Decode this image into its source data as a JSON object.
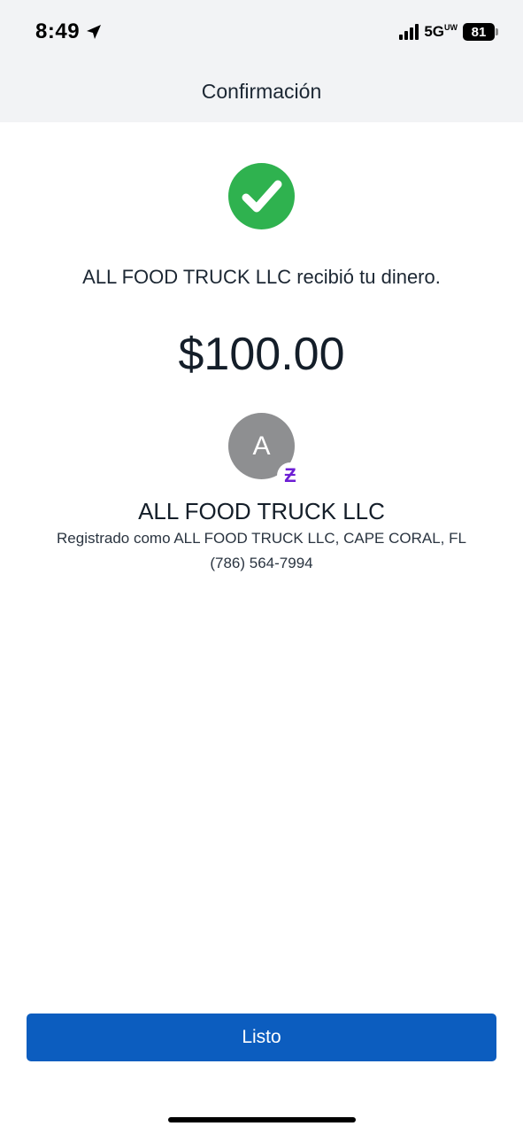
{
  "status_bar": {
    "time": "8:49",
    "location_icon": "location-arrow-icon",
    "network": "5G",
    "network_suffix": "UW",
    "battery": "81"
  },
  "header": {
    "title": "Confirmación"
  },
  "confirmation": {
    "status_icon": "checkmark-icon",
    "message": "ALL FOOD TRUCK LLC recibió tu dinero.",
    "amount": "$100.00"
  },
  "recipient": {
    "avatar_initial": "A",
    "badge_icon": "zelle-icon",
    "badge_glyph": "Ƶ",
    "name": "ALL FOOD TRUCK LLC",
    "registered_as": "Registrado como ALL FOOD TRUCK LLC, CAPE CORAL, FL",
    "phone": "(786) 564-7994"
  },
  "actions": {
    "done_label": "Listo"
  },
  "colors": {
    "success_green": "#2fb24f",
    "primary_blue": "#0c5dbf",
    "zelle_purple": "#6d1ed4",
    "avatar_gray": "#8e8f91"
  }
}
